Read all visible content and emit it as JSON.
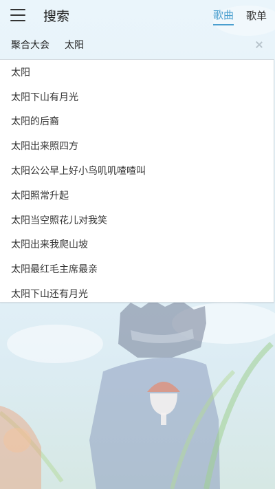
{
  "header": {
    "title": "搜索",
    "tabs": [
      {
        "label": "歌曲",
        "active": true
      },
      {
        "label": "歌单",
        "active": false
      }
    ]
  },
  "search": {
    "source_label": "聚合大会",
    "query": "太阳"
  },
  "suggestions": [
    "太阳",
    "太阳下山有月光",
    "太阳的后裔",
    "太阳出来照四方",
    "太阳公公早上好小鸟叽叽喳喳叫",
    "太阳照常升起",
    "太阳当空照花儿对我笑",
    "太阳出来我爬山坡",
    "太阳最红毛主席最亲",
    "太阳下山还有月光"
  ],
  "colors": {
    "accent": "#4a9fcf",
    "text": "#333333",
    "background": "#e3f1f8"
  },
  "icons": {
    "menu": "hamburger-menu-icon",
    "clear": "close-icon"
  }
}
